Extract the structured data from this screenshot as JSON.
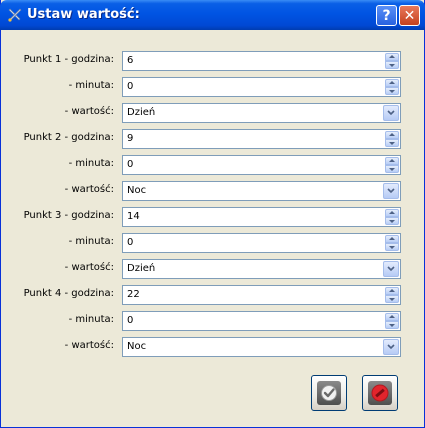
{
  "window": {
    "title": "Ustaw wartość:",
    "help_label": "?",
    "close_label": "✕"
  },
  "rows": [
    {
      "label": "Punkt 1 - godzina:",
      "value": "6",
      "type": "spin"
    },
    {
      "label": "- minuta:",
      "value": "0",
      "type": "spin"
    },
    {
      "label": "- wartość:",
      "value": "Dzień",
      "type": "combo"
    },
    {
      "label": "Punkt 2 - godzina:",
      "value": "9",
      "type": "spin"
    },
    {
      "label": "- minuta:",
      "value": "0",
      "type": "spin"
    },
    {
      "label": "- wartość:",
      "value": "Noc",
      "type": "combo"
    },
    {
      "label": "Punkt 3 - godzina:",
      "value": "14",
      "type": "spin"
    },
    {
      "label": "- minuta:",
      "value": "0",
      "type": "spin"
    },
    {
      "label": "- wartość:",
      "value": "Dzień",
      "type": "combo"
    },
    {
      "label": "Punkt 4 - godzina:",
      "value": "22",
      "type": "spin"
    },
    {
      "label": "- minuta:",
      "value": "0",
      "type": "spin"
    },
    {
      "label": "- wartość:",
      "value": "Noc",
      "type": "combo"
    }
  ],
  "buttons": {
    "ok_icon": "checkmark-icon",
    "cancel_icon": "no-entry-icon"
  },
  "colors": {
    "titlebar": "#0054e3",
    "window_bg": "#ece9d8",
    "field_border": "#7f9db9"
  }
}
